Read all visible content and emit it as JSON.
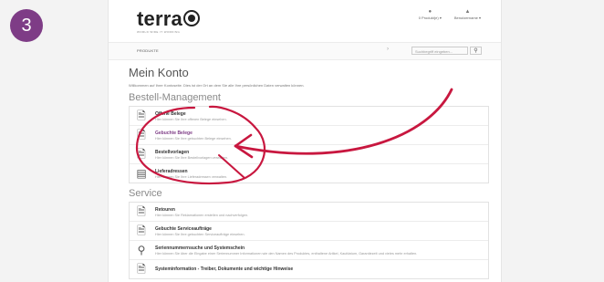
{
  "step": "3",
  "header": {
    "logo": "terra",
    "tagline": "WORLD WIDE IT WORKING",
    "links": [
      {
        "icon": "lock-icon",
        "label": "0 Produkt(e) ▾"
      },
      {
        "icon": "user-icon",
        "label": "Benutzername ▾"
      }
    ]
  },
  "nav": {
    "products": "PRODUKTE",
    "search_placeholder": "Suchbegriff eingeben..."
  },
  "main": {
    "title": "Mein Konto",
    "welcome": "Willkommen auf Ihrer Kontoseite. Dies ist der Ort an dem Sie alle Ihre persönlichen Daten verwalten können.",
    "sections": [
      {
        "title": "Bestell-Management",
        "items": [
          {
            "icon": "document-icon",
            "title": "Offene Belege",
            "desc": "Hier können Sie Ihre offenen Belege einsehen."
          },
          {
            "icon": "document-icon",
            "title": "Gebuchte Belege",
            "desc": "Hier können Sie Ihre gebuchten Belege einsehen.",
            "active": true
          },
          {
            "icon": "document-icon",
            "title": "Bestellvorlagen",
            "desc": "Hier können Sie Ihre Bestellvorlagen verwalten."
          },
          {
            "icon": "address-card-icon",
            "title": "Lieferadressen",
            "desc": "Hier können Sie Ihre Lieferadressen verwalten."
          }
        ]
      },
      {
        "title": "Service",
        "items": [
          {
            "icon": "document-icon",
            "title": "Retouren",
            "desc": "Hier können Sie Reklamationen erstellen und nachverfolgen."
          },
          {
            "icon": "document-icon",
            "title": "Gebuchte Serviceaufträge",
            "desc": "Hier können Sie Ihre gebuchten Serviceaufträge einsehen."
          },
          {
            "icon": "search-icon",
            "title": "Seriennummernsuche und Systemschein",
            "desc": "Hier können Sie über die Eingabe einer Seriennummer Informationen wie den Namen des Produktes, enthaltene Artikel, Kaufdatum, Garantiezeit und vieles mehr erhalten."
          },
          {
            "icon": "document-icon",
            "title": "Systeminformation - Treiber, Dokumente und wichtige Hinweise",
            "desc": ""
          }
        ]
      }
    ]
  }
}
